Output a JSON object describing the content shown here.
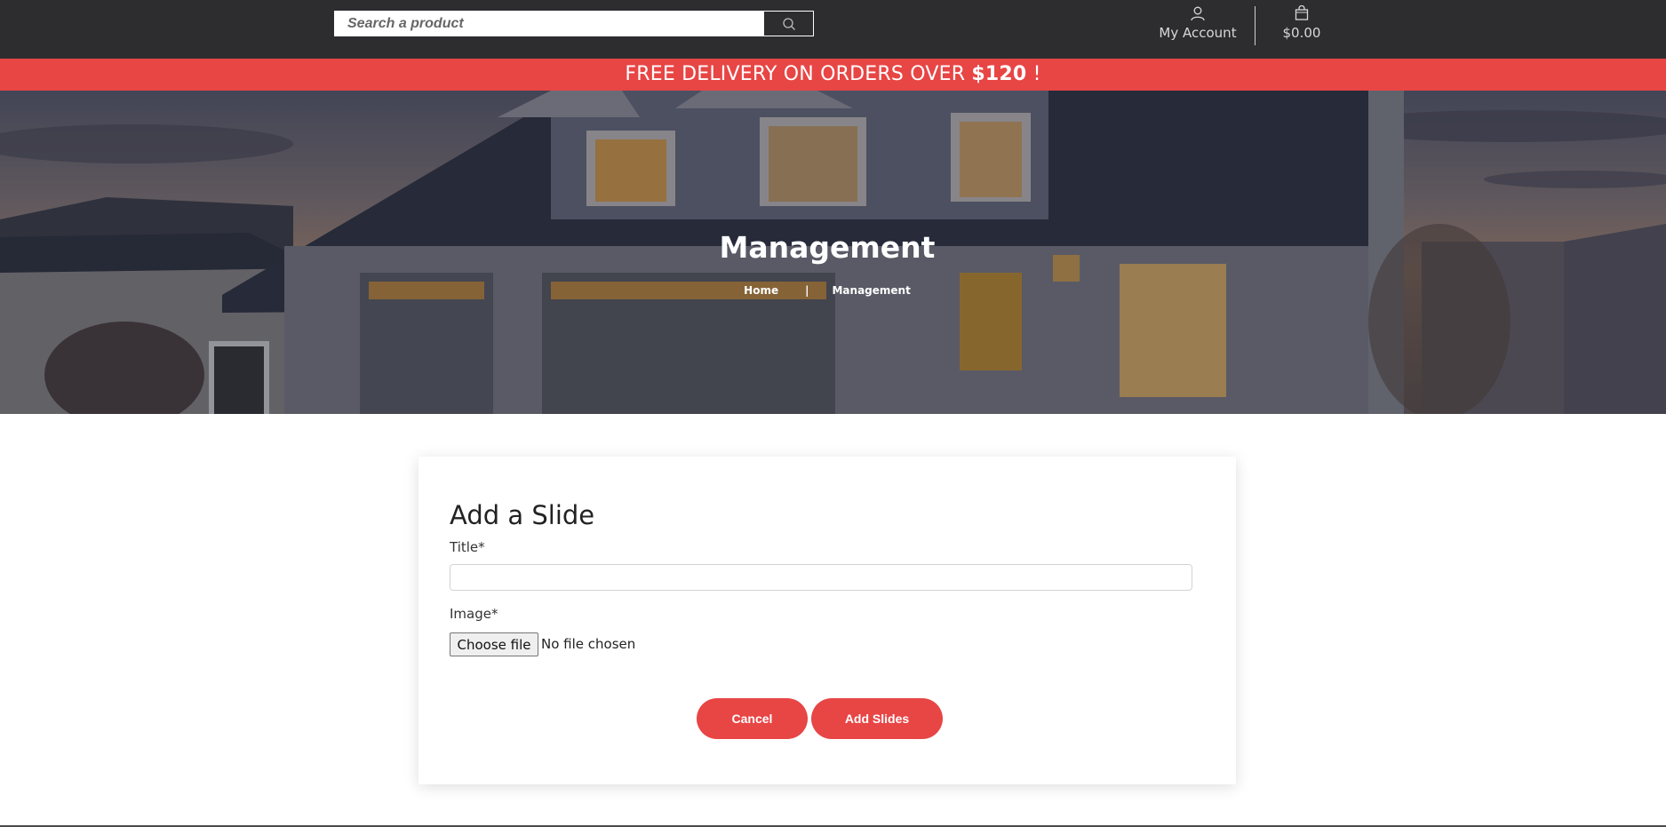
{
  "header": {
    "search": {
      "placeholder": "Search a product",
      "icon": "search-icon"
    },
    "account": {
      "label": "My Account",
      "icon": "user-icon"
    },
    "cart": {
      "label": "$0.00",
      "icon": "shopping-bag-icon"
    }
  },
  "promo": {
    "text_main": "FREE DELIVERY ON ORDERS OVER ",
    "text_amount": "$120",
    "text_end": " !"
  },
  "hero": {
    "title": "Management",
    "breadcrumb": {
      "home": "Home",
      "separator": "|",
      "current": "Management"
    }
  },
  "form": {
    "heading": "Add a Slide",
    "title_label": "Title*",
    "title_value": "",
    "image_label": "Image*",
    "file_button": "Choose file",
    "file_status": "No file chosen",
    "cancel_label": "Cancel",
    "submit_label": "Add Slides"
  },
  "colors": {
    "accent": "#e84545",
    "topbar": "#2d2d2f"
  }
}
